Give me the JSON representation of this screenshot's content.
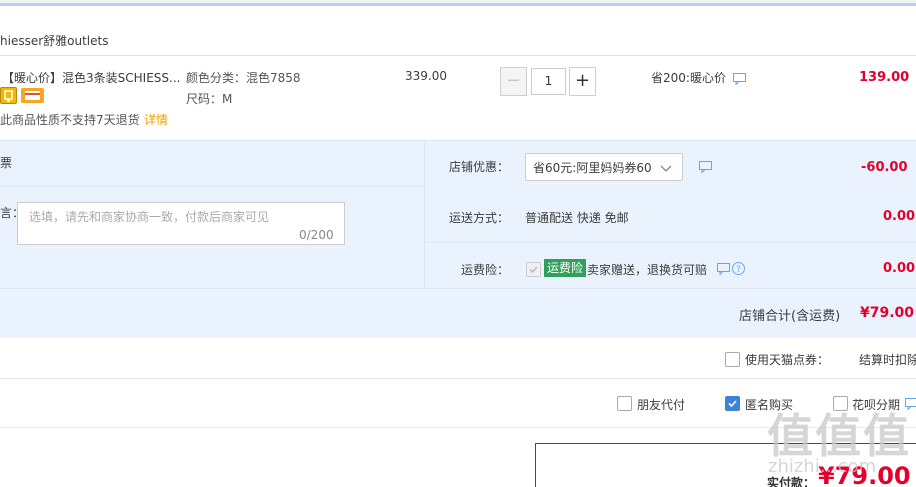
{
  "shop": {
    "name": "hiesser舒雅outlets"
  },
  "item": {
    "title": "【暖心价】混色3条装SCHIESS...",
    "sku_color": "颜色分类：混色7858",
    "sku_size": "尺码：M",
    "notice": "此商品性质不支持7天退货",
    "notice_link": "详情",
    "unit_price": "339.00",
    "quantity": "1",
    "promo": "省200:暖心价",
    "subtotal": "139.00"
  },
  "invoice": {
    "label": "票"
  },
  "message": {
    "label": "言：",
    "placeholder": "选填，请先和商家协商一致，付款后商家可见",
    "counter": "0/200"
  },
  "shop_discount": {
    "label": "店铺优惠：",
    "selected": "省60元:阿里妈妈券60",
    "amount": "-60.00"
  },
  "shipping": {
    "label": "运送方式：",
    "value": "普通配送 快递 免邮",
    "amount": "0.00"
  },
  "insurance": {
    "label": "运费险：",
    "tag": "运费险",
    "text": "卖家赠送，退换货可赔",
    "amount": "0.00"
  },
  "shop_total": {
    "label": "店铺合计(含运费)",
    "value": "¥79.00"
  },
  "tmall_points": {
    "label": "使用天猫点券：",
    "note": "结算时扣除"
  },
  "options": {
    "friend_pay": "朋友代付",
    "anonymous": "匿名购买",
    "huabei": "花呗分期"
  },
  "payment": {
    "label": "实付款：",
    "value": "¥79.00"
  },
  "watermark": {
    "main": "值值值",
    "sub": "zhizhi…com"
  },
  "colors": {
    "accent_red": "#e4002b",
    "blue_bg": "#eaf3fd",
    "check_blue": "#3d83d9"
  },
  "icons": [
    "message-icon",
    "question-icon",
    "chevron-down-icon",
    "check-icon"
  ]
}
